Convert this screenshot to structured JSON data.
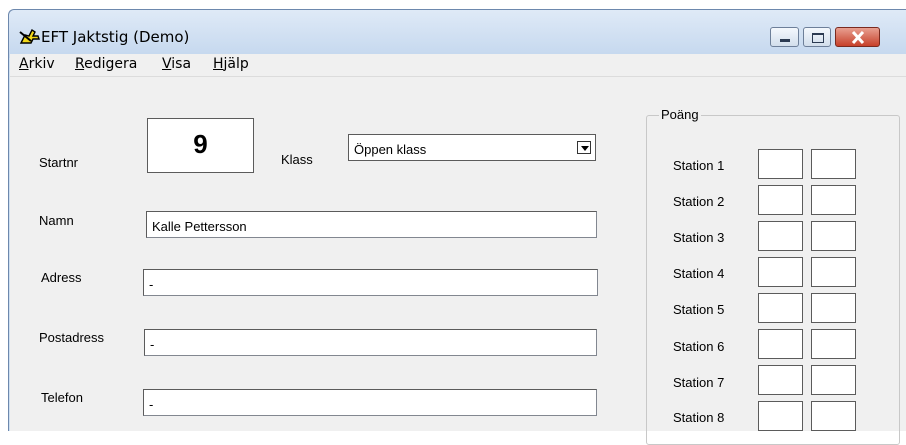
{
  "window": {
    "title": "EFT Jaktstig (Demo)",
    "icon": "hunter-app-icon",
    "controls": [
      "minimize-icon",
      "maximize-icon",
      "close-icon"
    ]
  },
  "menu": {
    "items": [
      {
        "key": "A",
        "rest": "rkiv"
      },
      {
        "key": "R",
        "rest": "edigera"
      },
      {
        "key": "V",
        "rest": "isa"
      },
      {
        "key": "H",
        "rest": "jälp"
      }
    ]
  },
  "form": {
    "startnr_label": "Startnr",
    "startnr_value": "9",
    "klass_label": "Klass",
    "klass_value": "Öppen klass",
    "namn_label": "Namn",
    "namn_value": "Kalle Pettersson",
    "adress_label": "Adress",
    "adress_value": "-",
    "postadress_label": "Postadress",
    "postadress_value": "-",
    "telefon_label": "Telefon",
    "telefon_value": "-"
  },
  "points": {
    "title": "Poäng",
    "stations": [
      "Station 1",
      "Station 2",
      "Station 3",
      "Station 4",
      "Station 5",
      "Station 6",
      "Station 7",
      "Station 8"
    ]
  }
}
